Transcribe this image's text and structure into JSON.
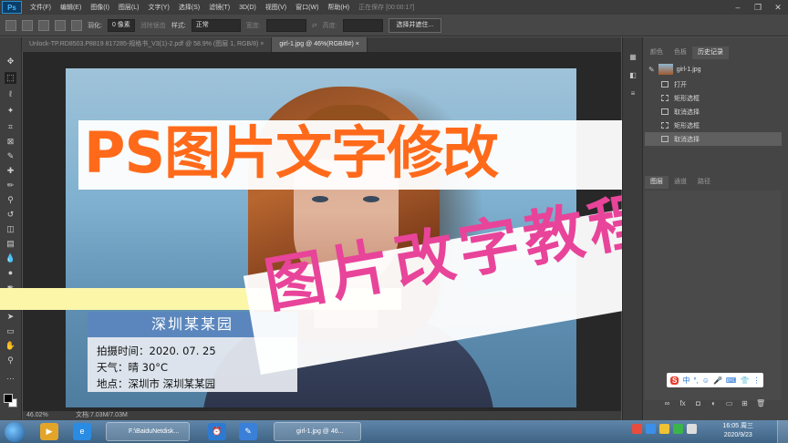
{
  "app": {
    "logo": "Ps",
    "menu": [
      "文件(F)",
      "编辑(E)",
      "图像(I)",
      "图层(L)",
      "文字(Y)",
      "选择(S)",
      "滤镜(T)",
      "3D(D)",
      "视图(V)",
      "窗口(W)",
      "帮助(H)",
      "正在保存 [00:00:17]"
    ]
  },
  "options": {
    "feather_label": "羽化:",
    "feather_value": "0 像素",
    "antialias_label": "消除锯齿",
    "style_label": "样式:",
    "style_value": "正常",
    "width_label": "宽度:",
    "height_label": "高度:",
    "select_mask_button": "选择并遮住..."
  },
  "tabs": [
    {
      "label": "Unlock-TP.RD8503.P8819 817285-规格书_V3(1)-2.pdf @ 58.9% (图层 1, RGB/8) ×",
      "active": false
    },
    {
      "label": "girl-1.jpg @ 46%(RGB/8#) ×",
      "active": true
    }
  ],
  "overlay": {
    "title": "PS图片文字修改",
    "subtitle": "图片改字教程"
  },
  "caption": {
    "title": "深圳某某园",
    "lines": [
      "拍摄时间：2020. 07. 25",
      "天气：晴  30°C",
      "地点：深圳市  深圳某某园"
    ]
  },
  "panels": {
    "top_tabs": [
      "颜色",
      "色板",
      "历史记录"
    ],
    "history_snapshot": "girl-1.jpg",
    "history": [
      {
        "label": "打开",
        "selected": false
      },
      {
        "label": "矩形选框",
        "selected": false
      },
      {
        "label": "取消选择",
        "selected": false
      },
      {
        "label": "矩形选框",
        "selected": false
      },
      {
        "label": "取消选择",
        "selected": true
      }
    ],
    "layer_tabs": [
      "图层",
      "通道",
      "路径"
    ],
    "ime": {
      "logo": "S",
      "items": [
        "中",
        "°,",
        "☺",
        "🎤",
        "⌨",
        "👕",
        "⋮"
      ]
    }
  },
  "status": {
    "zoom": "46.02%",
    "doc": "文档:7.03M/7.03M"
  },
  "taskbar": {
    "tasks": [
      "F:\\BaiduNetdisk...",
      "girl-1.jpg @ 46..."
    ],
    "time": "16:05 周三",
    "date": "2020/9/23"
  },
  "colors": {
    "title_orange": "#ff6a1a",
    "subtitle_pink": "#e8449a",
    "caption_blue": "#5a86bd"
  }
}
